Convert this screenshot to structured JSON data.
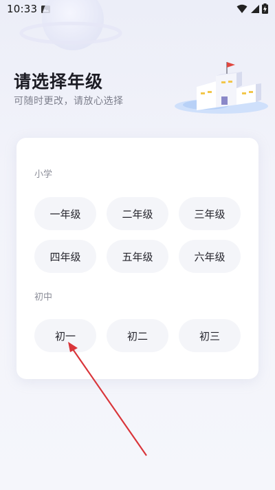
{
  "status_bar": {
    "time": "10:33"
  },
  "header": {
    "title": "请选择年级",
    "subtitle": "可随时更改，请放心选择"
  },
  "card": {
    "sections": [
      {
        "label": "小学",
        "grades": [
          "一年级",
          "二年级",
          "三年级",
          "四年级",
          "五年级",
          "六年级"
        ]
      },
      {
        "label": "初中",
        "grades": [
          "初一",
          "初二",
          "初三"
        ]
      }
    ]
  },
  "colors": {
    "arrow": "#d9353a",
    "flag": "#e0473f",
    "button_bg": "#f4f5f9"
  }
}
